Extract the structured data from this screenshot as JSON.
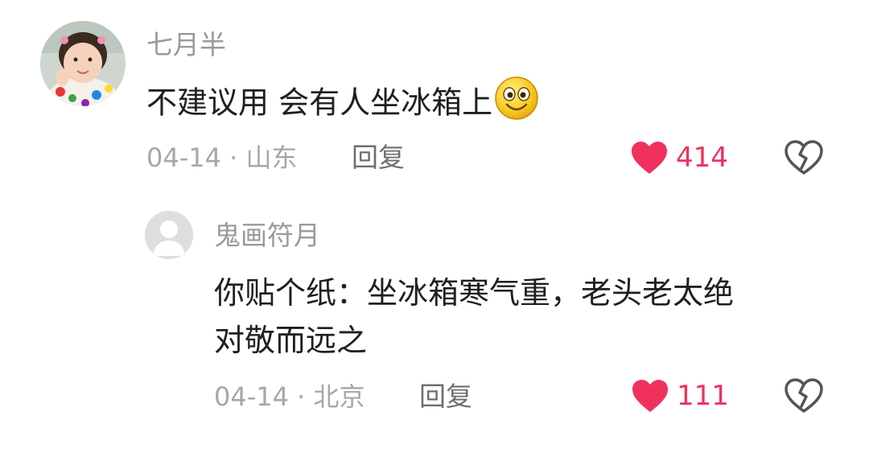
{
  "comment": {
    "username": "七月半",
    "text": "不建议用 会有人坐冰箱上",
    "emoji_icon": "smiley-emoji-icon",
    "date": "04-14",
    "separator": "·",
    "location": "山东",
    "reply_label": "回复",
    "like_count": "414",
    "like_color": "#f0315e"
  },
  "reply": {
    "username": "鬼画符月",
    "text_line1": "你贴个纸：坐冰箱寒气重，老头老太绝",
    "text_line2": "对敬而远之",
    "date": "04-14",
    "separator": "·",
    "location": "北京",
    "reply_label": "回复",
    "like_count": "111",
    "like_color": "#f0315e"
  }
}
